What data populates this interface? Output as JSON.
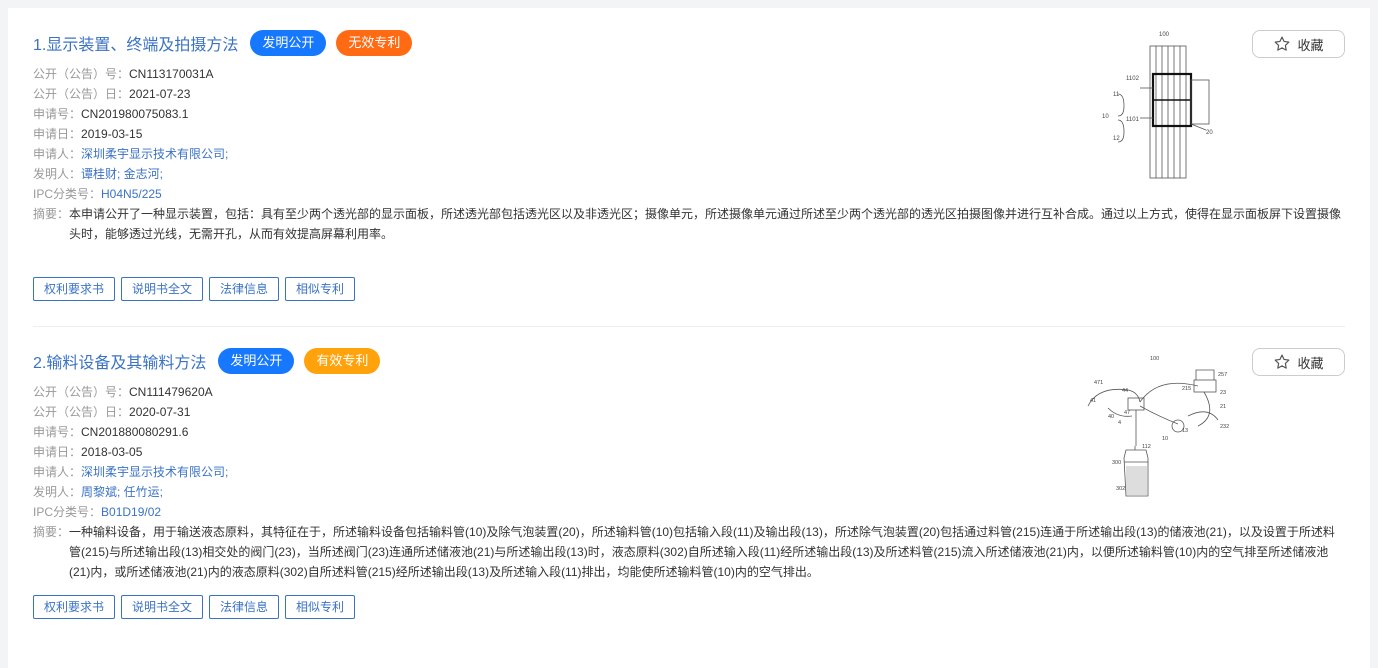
{
  "results": [
    {
      "index": "1.",
      "title": "显示装置、终端及拍摄方法",
      "badges": [
        {
          "label": "发明公开",
          "color": "#1677ff"
        },
        {
          "label": "无效专利",
          "color": "#ff6a13"
        }
      ],
      "fields": [
        {
          "key": "公开（公告）号：",
          "value": "CN113170031A",
          "link": false
        },
        {
          "key": "公开（公告）日：",
          "value": "2021-07-23",
          "link": false
        },
        {
          "key": "申请号：",
          "value": "CN201980075083.1",
          "link": false
        },
        {
          "key": "申请日：",
          "value": "2019-03-15",
          "link": false
        },
        {
          "key": "申请人：",
          "value": "深圳柔宇显示技术有限公司;",
          "link": true
        },
        {
          "key": "发明人：",
          "value": "谭桂财;  金志河;",
          "link": true
        },
        {
          "key": "IPC分类号：",
          "value": "H04N5/225",
          "link": true
        }
      ],
      "abstract_label": "摘要：",
      "abstract": "本申请公开了一种显示装置，包括：具有至少两个透光部的显示面板，所述透光部包括透光区以及非透光区；摄像单元，所述摄像单元通过所述至少两个透光部的透光区拍摄图像并进行互补合成。通过以上方式，使得在显示面板屏下设置摄像头时，能够透过光线，无需开孔，从而有效提高屏幕利用率。",
      "actions": [
        "权利要求书",
        "说明书全文",
        "法律信息",
        "相似专利"
      ],
      "favorite_label": "收藏",
      "drawing_labels": [
        "100",
        "1102",
        "11",
        "10",
        "1101",
        "12",
        "20"
      ]
    },
    {
      "index": "2.",
      "title": "输料设备及其输料方法",
      "badges": [
        {
          "label": "发明公开",
          "color": "#1677ff"
        },
        {
          "label": "有效专利",
          "color": "#ffa20c"
        }
      ],
      "fields": [
        {
          "key": "公开（公告）号：",
          "value": "CN111479620A",
          "link": false
        },
        {
          "key": "公开（公告）日：",
          "value": "2020-07-31",
          "link": false
        },
        {
          "key": "申请号：",
          "value": "CN201880080291.6",
          "link": false
        },
        {
          "key": "申请日：",
          "value": "2018-03-05",
          "link": false
        },
        {
          "key": "申请人：",
          "value": "深圳柔宇显示技术有限公司;",
          "link": true
        },
        {
          "key": "发明人：",
          "value": "周黎斌;  任竹运;",
          "link": true
        },
        {
          "key": "IPC分类号：",
          "value": "B01D19/02",
          "link": true
        }
      ],
      "abstract_label": "摘要：",
      "abstract": "一种输料设备，用于输送液态原料，其特征在于，所述输料设备包括输料管(10)及除气泡装置(20)，所述输料管(10)包括输入段(11)及输出段(13)，所述除气泡装置(20)包括通过料管(215)连通于所述输出段(13)的储液池(21)，以及设置于所述料管(215)与所述输出段(13)相交处的阀门(23)，当所述阀门(23)连通所述储液池(21)与所述输出段(13)时，液态原料(302)自所述输入段(11)经所述输出段(13)及所述料管(215)流入所述储液池(21)内，以便所述输料管(10)内的空气排至所述储液池(21)内，或所述储液池(21)内的液态原料(302)自所述料管(215)经所述输出段(13)及所述输入段(11)排出，均能使所述输料管(10)内的空气排出。",
      "actions": [
        "权利要求书",
        "说明书全文",
        "法律信息",
        "相似专利"
      ],
      "favorite_label": "收藏",
      "drawing_labels": [
        "100",
        "471",
        "41",
        "44",
        "40",
        "4",
        "47",
        "112",
        "300",
        "302",
        "215",
        "257",
        "23",
        "21",
        "232",
        "13",
        "10"
      ]
    }
  ]
}
